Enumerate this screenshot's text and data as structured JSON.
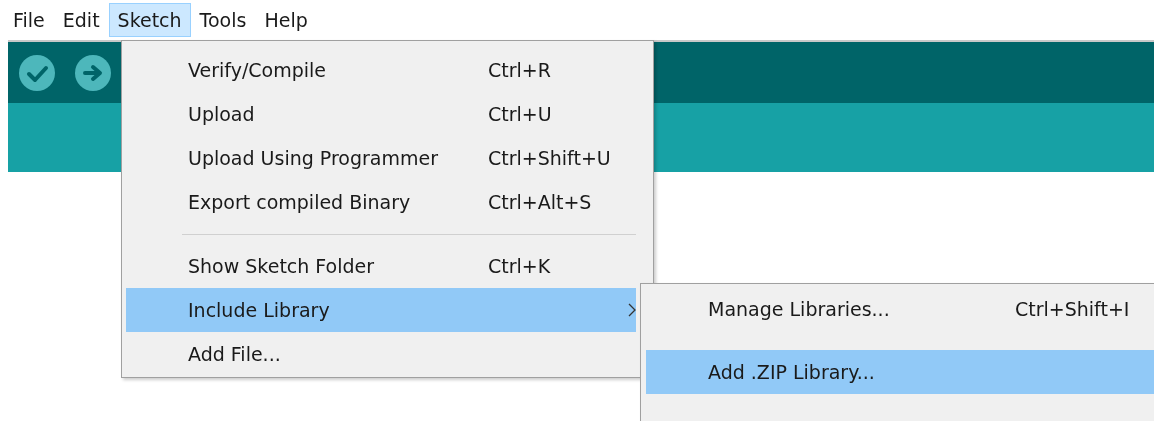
{
  "menu_bar": [
    {
      "label": "File",
      "selected": false
    },
    {
      "label": "Edit",
      "selected": false
    },
    {
      "label": "Sketch",
      "selected": true
    },
    {
      "label": "Tools",
      "selected": false
    },
    {
      "label": "Help",
      "selected": false
    }
  ],
  "toolbar": {
    "buttons": [
      {
        "kind": "verify"
      },
      {
        "kind": "upload"
      }
    ]
  },
  "sketch_menu": {
    "items": [
      {
        "kind": "item",
        "label": "Verify/Compile",
        "shortcut": "Ctrl+R",
        "selected": false
      },
      {
        "kind": "item",
        "label": "Upload",
        "shortcut": "Ctrl+U",
        "selected": false
      },
      {
        "kind": "item",
        "label": "Upload Using Programmer",
        "shortcut": "Ctrl+Shift+U",
        "selected": false
      },
      {
        "kind": "item",
        "label": "Export compiled Binary",
        "shortcut": "Ctrl+Alt+S",
        "selected": false
      },
      {
        "kind": "separator"
      },
      {
        "kind": "item",
        "label": "Show Sketch Folder",
        "shortcut": "Ctrl+K",
        "selected": false
      },
      {
        "kind": "submenu",
        "label": "Include Library",
        "selected": true
      },
      {
        "kind": "item",
        "label": "Add File...",
        "selected": false
      }
    ]
  },
  "include_library_submenu": {
    "items": [
      {
        "kind": "item",
        "label": "Manage Libraries...",
        "shortcut": "Ctrl+Shift+I",
        "selected": false
      },
      {
        "kind": "item",
        "label": "Add .ZIP Library...",
        "selected": true
      }
    ]
  }
}
